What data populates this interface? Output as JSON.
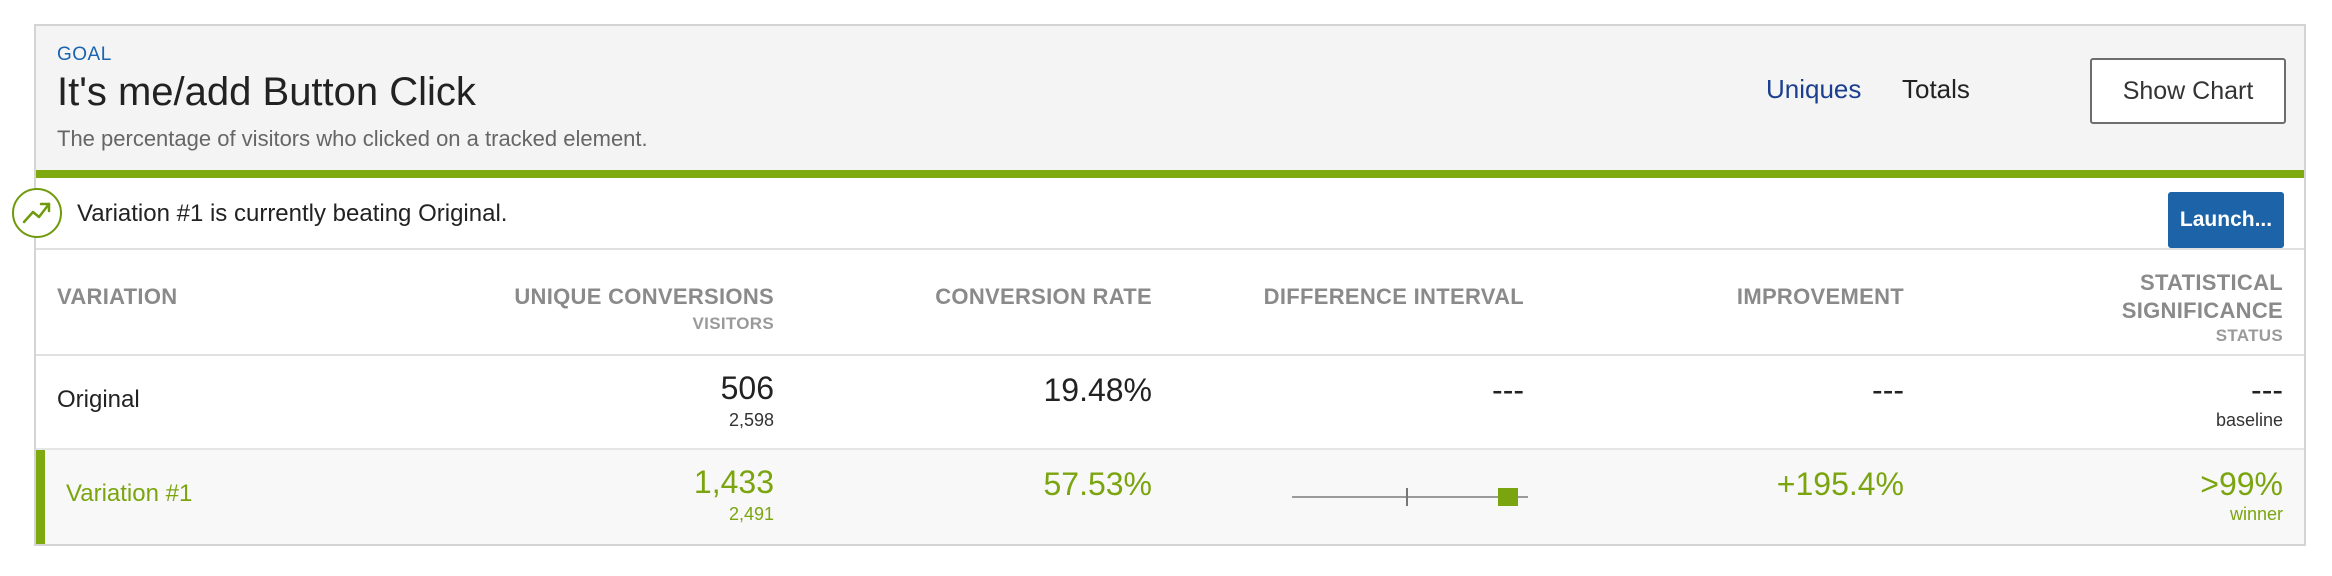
{
  "goal": {
    "label": "GOAL",
    "title": "It's me/add Button Click",
    "description": "The percentage of visitors who clicked on a tracked element."
  },
  "toggle": {
    "uniques": "Uniques",
    "totals": "Totals",
    "active": "Uniques"
  },
  "show_chart_label": "Show Chart",
  "banner": {
    "text": "Variation #1 is currently beating Original.",
    "launch_label": "Launch...",
    "icon": "trend-up-icon"
  },
  "columns": {
    "variation": "VARIATION",
    "unique_conversions": "UNIQUE CONVERSIONS",
    "unique_conversions_sub": "VISITORS",
    "conversion_rate": "CONVERSION RATE",
    "difference_interval": "DIFFERENCE INTERVAL",
    "improvement": "IMPROVEMENT",
    "stat_sig_line1": "STATISTICAL",
    "stat_sig_line2": "SIGNIFICANCE",
    "stat_sig_sub": "STATUS"
  },
  "rows": [
    {
      "name": "Original",
      "conversions": "506",
      "visitors": "2,598",
      "conversion_rate": "19.48%",
      "difference_interval": "---",
      "improvement": "---",
      "significance": "---",
      "status": "baseline"
    },
    {
      "name": "Variation #1",
      "conversions": "1,433",
      "visitors": "2,491",
      "conversion_rate": "57.53%",
      "difference_interval": "",
      "improvement": "+195.4%",
      "significance": ">99%",
      "status": "winner"
    }
  ],
  "colors": {
    "accent_green": "#7faa0f",
    "link_blue": "#1a63b0",
    "button_blue": "#1c63a8"
  }
}
